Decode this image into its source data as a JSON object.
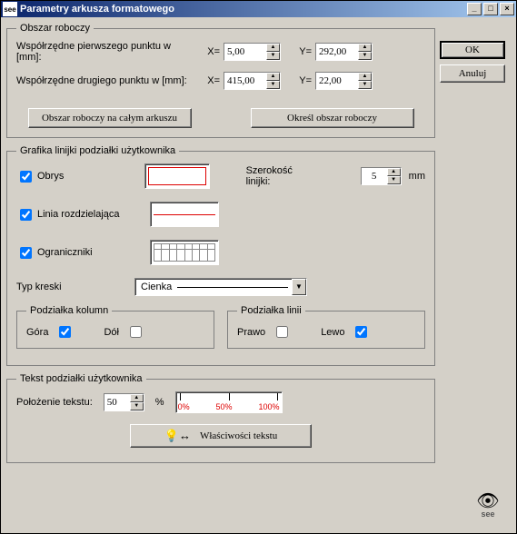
{
  "window": {
    "title": "Parametry arkusza formatowego",
    "icon_text": "see"
  },
  "buttons": {
    "ok": "OK",
    "cancel": "Anuluj"
  },
  "obszar": {
    "legend": "Obszar roboczy",
    "p1_label": "Współrzędne pierwszego punktu w [mm]:",
    "p2_label": "Współrzędne drugiego punktu w [mm]:",
    "x_label": "X=",
    "y_label": "Y=",
    "p1_x": "5,00",
    "p1_y": "292,00",
    "p2_x": "415,00",
    "p2_y": "22,00",
    "btn_whole": "Obszar roboczy na całym arkuszu",
    "btn_define": "Określ obszar roboczy"
  },
  "grafika": {
    "legend": "Grafika linijki podziałki użytkownika",
    "obrys": "Obrys",
    "linia": "Linia rozdzielająca",
    "ogran": "Ograniczniki",
    "szer_label": "Szerokość linijki:",
    "szer_val": "5",
    "szer_unit": "mm",
    "typ_label": "Typ kreski",
    "typ_val": "Cienka",
    "kolumn_legend": "Podziałka kolumn",
    "gora": "Góra",
    "dol": "Dół",
    "linii_legend": "Podziałka linii",
    "prawo": "Prawo",
    "lewo": "Lewo",
    "obrys_checked": true,
    "linia_checked": true,
    "ogran_checked": true,
    "gora_checked": true,
    "dol_checked": false,
    "prawo_checked": false,
    "lewo_checked": true
  },
  "tekst": {
    "legend": "Tekst podziałki użytkownika",
    "pos_label": "Położenie tekstu:",
    "pos_val": "50",
    "pct": "%",
    "marks": {
      "m0": "0%",
      "m50": "50%",
      "m100": "100%"
    },
    "props_btn": "Właściwości tekstu"
  },
  "logo_text": "see"
}
